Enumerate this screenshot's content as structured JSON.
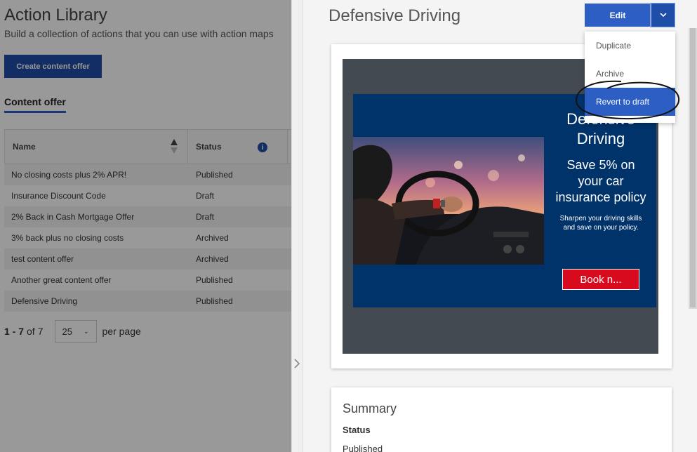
{
  "library": {
    "title": "Action Library",
    "subtitle": "Build a collection of actions that you can use with action maps",
    "create_button": "Create content offer",
    "tab": "Content offer"
  },
  "table": {
    "columns": {
      "name": "Name",
      "status": "Status"
    },
    "rows": [
      {
        "name": "No closing costs plus 2% APR!",
        "status": "Published"
      },
      {
        "name": "Insurance Discount Code",
        "status": "Draft"
      },
      {
        "name": "2% Back in Cash Mortgage Offer",
        "status": "Draft"
      },
      {
        "name": "3% back plus no closing costs",
        "status": "Archived"
      },
      {
        "name": "test content offer",
        "status": "Archived"
      },
      {
        "name": "Another great content offer",
        "status": "Published"
      },
      {
        "name": "Defensive Driving",
        "status": "Published"
      }
    ]
  },
  "pagination": {
    "range": "1 - 7",
    "of_label": "of",
    "total": "7",
    "per_page_value": "25",
    "per_page_label": "per page"
  },
  "detail": {
    "title": "Defensive Driving",
    "edit_label": "Edit",
    "menu": [
      "Duplicate",
      "Archive",
      "Revert to draft"
    ],
    "active_menu_item": "Revert to draft"
  },
  "offer": {
    "headline": "Defensive Driving",
    "subheadline": "Save 5% on your car insurance policy",
    "body": "Sharpen your driving skills and save on your policy.",
    "button": "Book n..."
  },
  "summary": {
    "title": "Summary",
    "status_label": "Status",
    "status_value": "Published"
  },
  "colors": {
    "primary": "#2c5ec4",
    "primary_dark": "#1f4ea8",
    "offer_bg": "#00336a",
    "offer_button": "#d80a1e",
    "preview_bg": "#434a52"
  }
}
